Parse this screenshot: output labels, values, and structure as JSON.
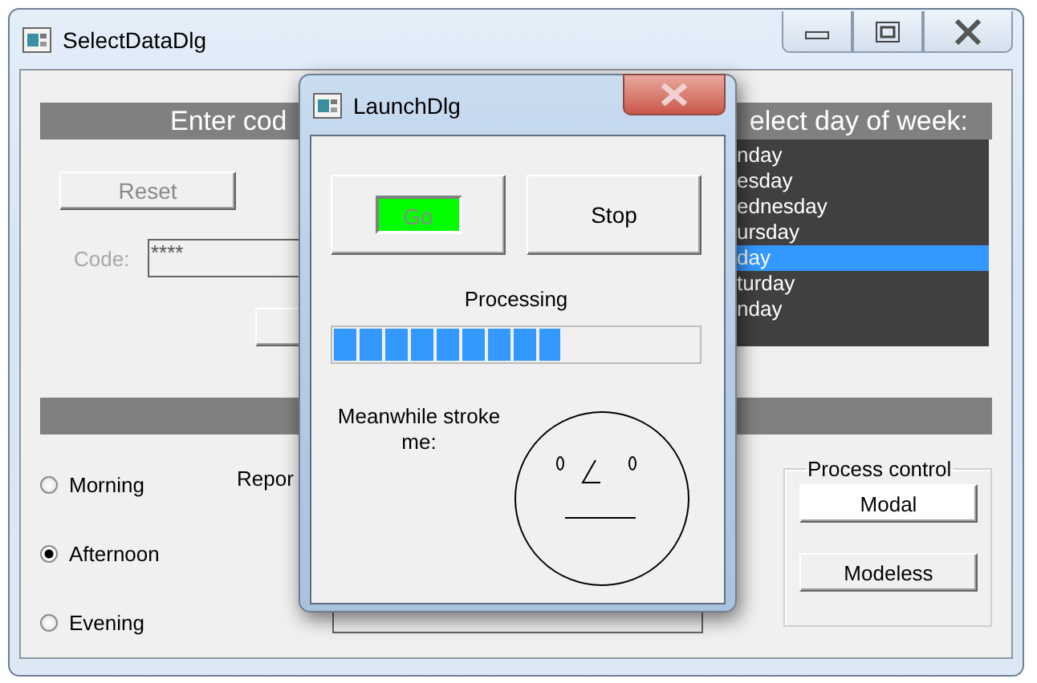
{
  "main_window": {
    "title": "SelectDataDlg",
    "header": {
      "left": "Enter cod",
      "right": "elect day of week:"
    },
    "reset_button": {
      "label": "Reset",
      "disabled": true
    },
    "code": {
      "label": "Code:",
      "value": "****"
    },
    "days": [
      {
        "label": "nday",
        "selected": false
      },
      {
        "label": "esday",
        "selected": false
      },
      {
        "label": "ednesday",
        "selected": false
      },
      {
        "label": "ursday",
        "selected": false
      },
      {
        "label": "day",
        "selected": true
      },
      {
        "label": "turday",
        "selected": false
      },
      {
        "label": "nday",
        "selected": false
      }
    ],
    "periods": [
      {
        "label": "Morning",
        "selected": false
      },
      {
        "label": "Afternoon",
        "selected": true
      },
      {
        "label": "Evening",
        "selected": false
      }
    ],
    "report_label": "Repor",
    "process_control": {
      "title": "Process control",
      "buttons": [
        "Modal",
        "Modeless"
      ]
    }
  },
  "launch_dialog": {
    "title": "LaunchDlg",
    "go_button": {
      "label": "Go"
    },
    "stop_button": {
      "label": "Stop"
    },
    "status": "Processing",
    "progress": {
      "level": 0.62
    },
    "prompt": "Meanwhile stroke me:"
  }
}
